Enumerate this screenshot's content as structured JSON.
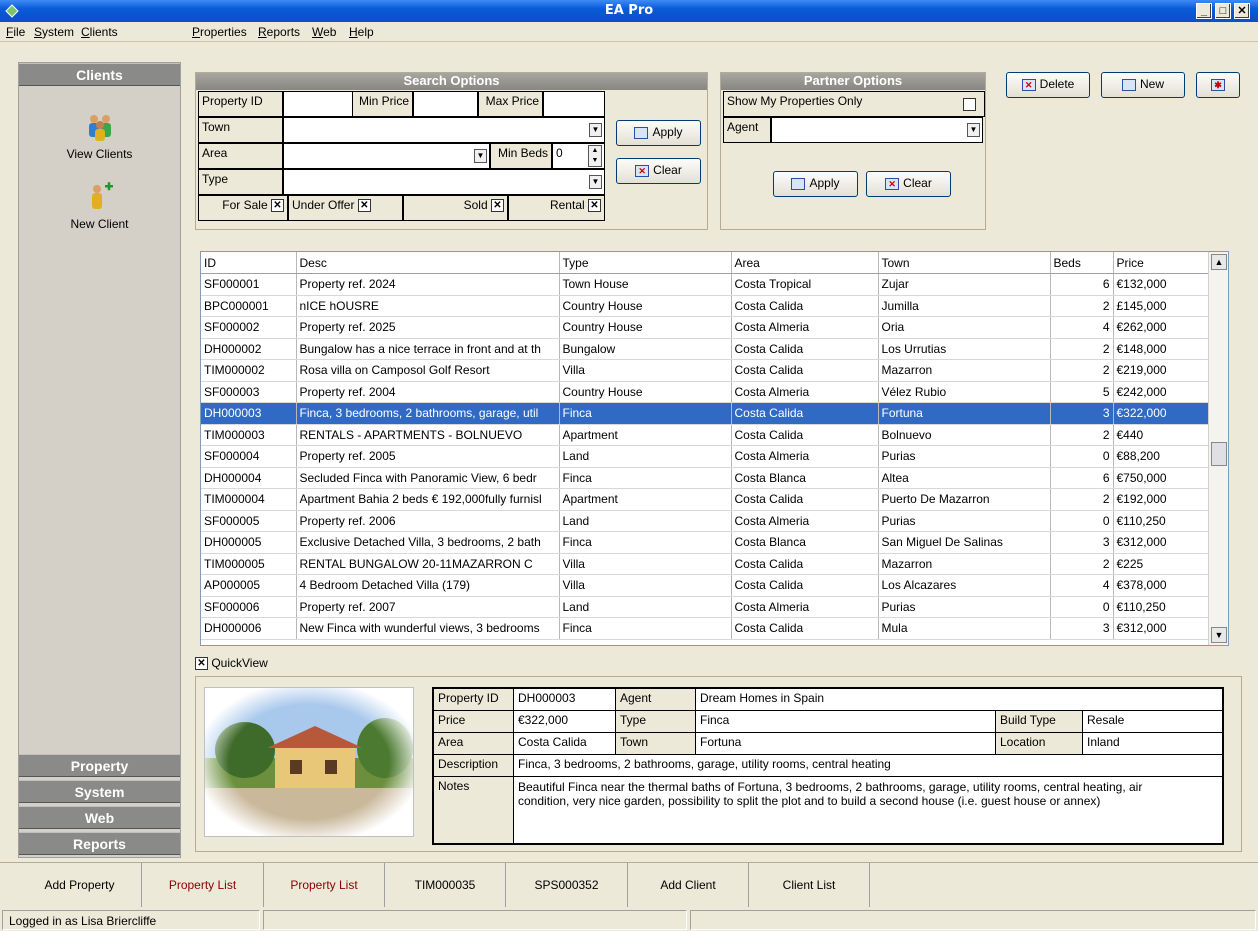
{
  "window": {
    "title": "EA Pro",
    "minimize": "_",
    "maximize": "□",
    "close": "✕"
  },
  "menu": [
    "File",
    "System",
    "Clients",
    "Properties",
    "Reports",
    "Web",
    "Help"
  ],
  "sidebar": {
    "header": "Clients",
    "items": [
      {
        "label": "View Clients",
        "icon": "people-icon"
      },
      {
        "label": "New Client",
        "icon": "add-person-icon"
      }
    ],
    "sections": [
      "Property",
      "System",
      "Web",
      "Reports"
    ]
  },
  "search": {
    "title": "Search Options",
    "property_id_label": "Property ID",
    "min_price_label": "Min Price",
    "max_price_label": "Max Price",
    "town_label": "Town",
    "area_label": "Area",
    "min_beds_label": "Min Beds",
    "min_beds_value": "0",
    "type_label": "Type",
    "for_sale": "For Sale",
    "under_offer": "Under Offer",
    "sold": "Sold",
    "rental": "Rental",
    "apply": "Apply",
    "clear": "Clear"
  },
  "partner": {
    "title": "Partner Options",
    "show_mine": "Show My Properties Only",
    "agent_label": "Agent",
    "apply": "Apply",
    "clear": "Clear"
  },
  "toolbar": {
    "delete": "Delete",
    "new": "New"
  },
  "grid": {
    "columns": [
      "ID",
      "Desc",
      "Type",
      "Area",
      "Town",
      "Beds",
      "Price"
    ],
    "rows": [
      [
        "SF000001",
        "Property ref. 2024",
        "Town House",
        "Costa Tropical",
        "Zujar",
        "6",
        "€132,000"
      ],
      [
        "BPC000001",
        "nICE hOUSRE",
        "Country House",
        "Costa Calida",
        "Jumilla",
        "2",
        "£145,000"
      ],
      [
        "SF000002",
        "Property ref. 2025",
        "Country House",
        "Costa Almeria",
        "Oria",
        "4",
        "€262,000"
      ],
      [
        "DH000002",
        "Bungalow has a nice terrace in front and at th",
        "Bungalow",
        "Costa Calida",
        "Los Urrutias",
        "2",
        "€148,000"
      ],
      [
        "TIM000002",
        "Rosa villa on Camposol Golf Resort",
        "Villa",
        "Costa Calida",
        "Mazarron",
        "2",
        "€219,000"
      ],
      [
        "SF000003",
        "Property ref. 2004",
        "Country House",
        "Costa Almeria",
        "Vélez Rubio",
        "5",
        "€242,000"
      ],
      [
        "DH000003",
        "Finca, 3 bedrooms, 2  bathrooms, garage, util",
        "Finca",
        "Costa Calida",
        "Fortuna",
        "3",
        "€322,000"
      ],
      [
        "TIM000003",
        "RENTALS - APARTMENTS - BOLNUEVO",
        "Apartment",
        "Costa Calida",
        "Bolnuevo",
        "2",
        "€440"
      ],
      [
        "SF000004",
        "Property ref. 2005",
        "Land",
        "Costa Almeria",
        "Purias",
        "0",
        "€88,200"
      ],
      [
        "DH000004",
        "Secluded Finca with Panoramic View, 6 bedr",
        "Finca",
        "Costa Blanca",
        "Altea",
        "6",
        "€750,000"
      ],
      [
        "TIM000004",
        "Apartment Bahia 2 beds € 192,000fully furnisl",
        "Apartment",
        "Costa Calida",
        "Puerto De Mazarron",
        "2",
        "€192,000"
      ],
      [
        "SF000005",
        "Property ref. 2006",
        "Land",
        "Costa Almeria",
        "Purias",
        "0",
        "€110,250"
      ],
      [
        "DH000005",
        "Exclusive Detached Villa, 3 bedrooms, 2 bath",
        "Finca",
        "Costa Blanca",
        "San Miguel De Salinas",
        "3",
        "€312,000"
      ],
      [
        "TIM000005",
        "RENTAL BUNGALOW 20-11MAZARRON C",
        "Villa",
        "Costa Calida",
        "Mazarron",
        "2",
        "€225"
      ],
      [
        "AP000005",
        "4 Bedroom Detached Villa (179)",
        "Villa",
        "Costa Calida",
        "Los Alcazares",
        "4",
        "€378,000"
      ],
      [
        "SF000006",
        "Property ref. 2007",
        "Land",
        "Costa Almeria",
        "Purias",
        "0",
        "€110,250"
      ],
      [
        "DH000006",
        "New Finca with wunderful views, 3 bedrooms",
        "Finca",
        "Costa Calida",
        "Mula",
        "3",
        "€312,000"
      ]
    ],
    "selected_index": 6
  },
  "quickview": {
    "label": "QuickView",
    "property_id_label": "Property ID",
    "property_id": "DH000003",
    "agent_label": "Agent",
    "agent": "Dream Homes in Spain",
    "price_label": "Price",
    "price": "€322,000",
    "type_label": "Type",
    "type": "Finca",
    "build_type_label": "Build Type",
    "build_type": "Resale",
    "area_label": "Area",
    "area": "Costa Calida",
    "town_label": "Town",
    "town": "Fortuna",
    "location_label": "Location",
    "location": "Inland",
    "description_label": "Description",
    "description": "Finca, 3 bedrooms, 2  bathrooms, garage, utility rooms, central heating",
    "notes_label": "Notes",
    "notes_line1": "Beautiful Finca near the thermal baths of Fortuna, 3 bedrooms, 2  bathrooms, garage, utility rooms, central heating, air",
    "notes_line2": "condition, very nice garden, possibility to split the plot and to build a second house (i.e. guest house or annex)"
  },
  "tabs": [
    "Add Property",
    "Property List",
    "Property List",
    "TIM000035",
    "SPS000352",
    "Add Client",
    "Client List"
  ],
  "status": {
    "user": "Logged in as Lisa Briercliffe"
  },
  "colors": {
    "title_bar": "#0a5ad8",
    "selection": "#316ac5",
    "tab_active_text": "#8b0000"
  }
}
